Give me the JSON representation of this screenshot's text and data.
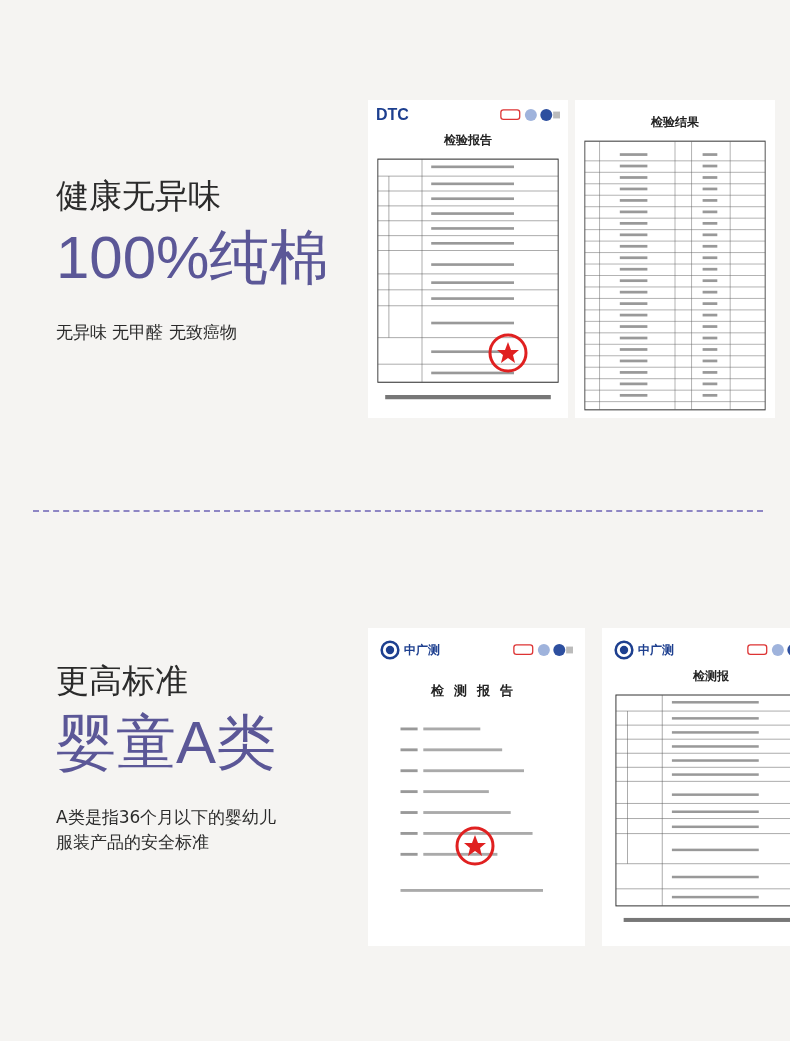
{
  "sections": [
    {
      "eyebrow": "健康无异味",
      "headline": "100%纯棉",
      "description": [
        "无异味 无甲醛 无致癌物"
      ],
      "documents": [
        {
          "kind": "form",
          "brand": "DTC",
          "title": "检验报告",
          "stamp": true
        },
        {
          "kind": "table",
          "title": "检验结果",
          "stamp": false
        }
      ]
    },
    {
      "eyebrow": "更高标准",
      "headline": "婴童A类",
      "description": [
        "A类是指36个月以下的婴幼儿",
        "服装产品的安全标准"
      ],
      "documents": [
        {
          "kind": "cover",
          "brand": "中广测",
          "title": "检测报告",
          "stamp": true
        },
        {
          "kind": "form",
          "brand": "中广测",
          "title": "检测报",
          "stamp": false
        }
      ]
    }
  ]
}
